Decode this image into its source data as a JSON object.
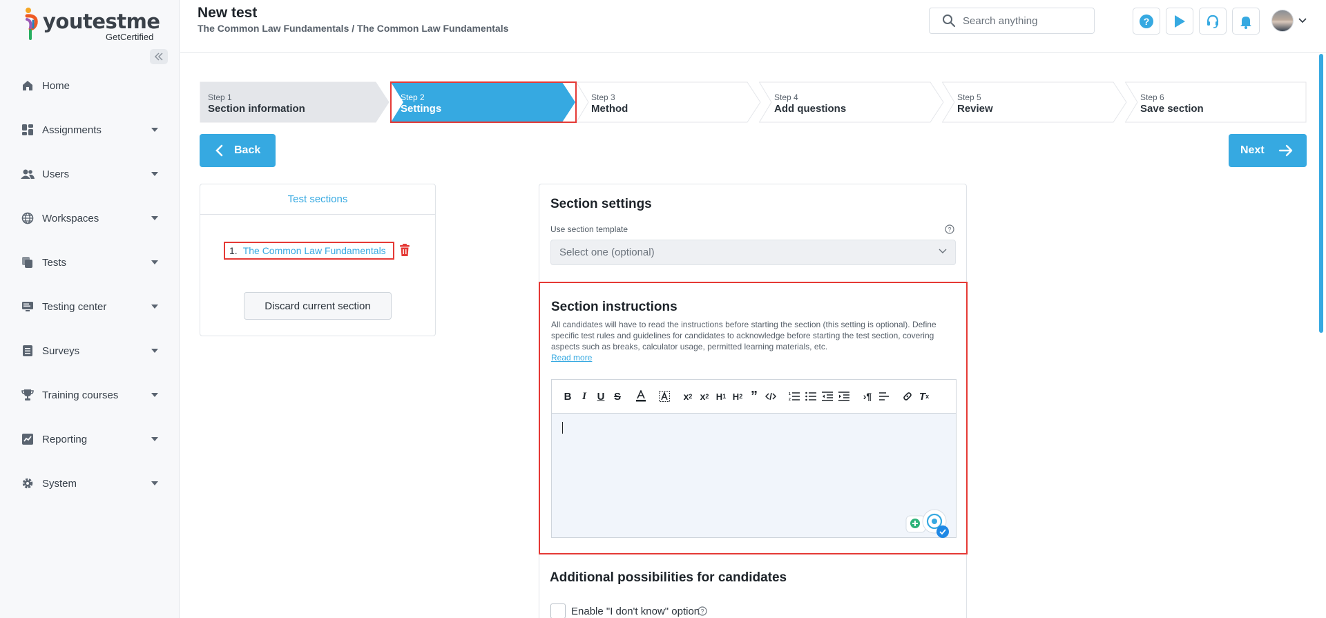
{
  "brand": {
    "name": "youtestme",
    "sub": "GetCertified"
  },
  "sidebar": {
    "items": [
      {
        "label": "Home",
        "icon": "home-icon"
      },
      {
        "label": "Assignments",
        "icon": "dashboard-icon"
      },
      {
        "label": "Users",
        "icon": "users-icon"
      },
      {
        "label": "Workspaces",
        "icon": "globe-icon"
      },
      {
        "label": "Tests",
        "icon": "copy-icon"
      },
      {
        "label": "Testing center",
        "icon": "monitor-icon"
      },
      {
        "label": "Surveys",
        "icon": "list-icon"
      },
      {
        "label": "Training courses",
        "icon": "trophy-icon"
      },
      {
        "label": "Reporting",
        "icon": "chart-icon"
      },
      {
        "label": "System",
        "icon": "gear-icon"
      }
    ]
  },
  "header": {
    "title": "New test",
    "breadcrumb": "The Common Law Fundamentals / The Common Law Fundamentals",
    "search_placeholder": "Search anything"
  },
  "stepper": {
    "steps": [
      {
        "num": "Step 1",
        "label": "Section information",
        "state": "done"
      },
      {
        "num": "Step 2",
        "label": "Settings",
        "state": "active"
      },
      {
        "num": "Step 3",
        "label": "Method",
        "state": "todo"
      },
      {
        "num": "Step 4",
        "label": "Add questions",
        "state": "todo"
      },
      {
        "num": "Step 5",
        "label": "Review",
        "state": "todo"
      },
      {
        "num": "Step 6",
        "label": "Save section",
        "state": "todo"
      }
    ]
  },
  "actions": {
    "back": "Back",
    "next": "Next"
  },
  "test_sections": {
    "title": "Test sections",
    "items": [
      {
        "num": "1.",
        "name": "The Common Law Fundamentals"
      }
    ],
    "discard": "Discard current section"
  },
  "section_settings": {
    "title": "Section settings",
    "template_label": "Use section template",
    "template_placeholder": "Select one (optional)"
  },
  "instructions": {
    "title": "Section instructions",
    "description": "All candidates will have to read the instructions before starting the section (this setting is optional). Define specific test rules and guidelines for candidates to acknowledge before starting the test section, covering aspects such as breaks, calculator usage, permitted learning materials, etc.",
    "read_more": "Read more"
  },
  "additional": {
    "title": "Additional possibilities for candidates",
    "idk_label": "Enable \"I don't know\" option"
  },
  "colors": {
    "accent": "#36a9e1",
    "highlight": "#e53935",
    "sidebar_bg": "#f7f8fa"
  }
}
